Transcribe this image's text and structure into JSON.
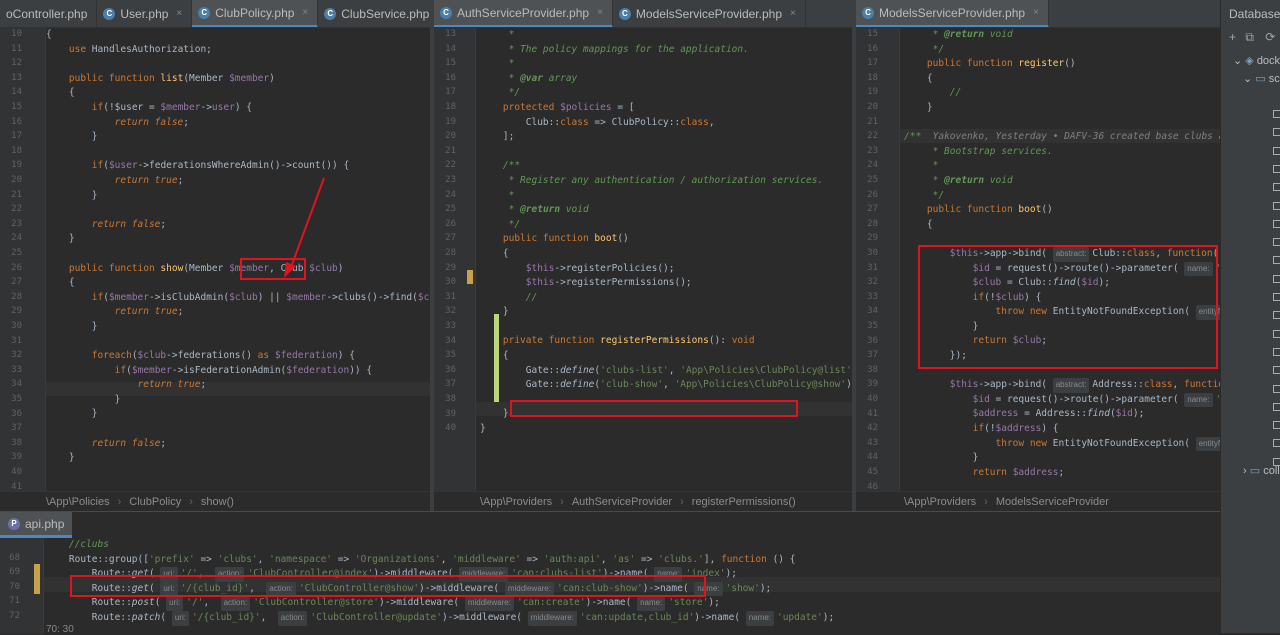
{
  "pane1": {
    "tabs": [
      {
        "label": "oController.php",
        "icon": "php-file-icon",
        "active": false
      },
      {
        "label": "User.php",
        "icon": "php-file-icon",
        "active": false
      },
      {
        "label": "ClubPolicy.php",
        "icon": "php-file-icon",
        "active": true
      },
      {
        "label": "ClubService.php",
        "icon": "php-file-icon",
        "active": false
      },
      {
        "label": "≡",
        "icon": "more-tabs-icon",
        "active": false
      }
    ],
    "line_numbers": [
      "10",
      "11",
      "12",
      "13",
      "14",
      "15",
      "16",
      "17",
      "18",
      "19",
      "20",
      "21",
      "22",
      "23",
      "24",
      "25",
      "26",
      "27",
      "28",
      "29",
      "30",
      "31",
      "32",
      "33",
      "34",
      "35",
      "36",
      "37",
      "38",
      "39",
      "40",
      "41"
    ],
    "breadcrumb": [
      "\\App\\Policies",
      "ClubPolicy",
      "show()"
    ]
  },
  "pane2": {
    "tabs": [
      {
        "label": "AuthServiceProvider.php",
        "icon": "php-file-icon",
        "active": true
      },
      {
        "label": "ModelsServiceProvider.php",
        "icon": "php-file-icon",
        "active": false
      }
    ],
    "line_numbers": [
      "13",
      "14",
      "15",
      "16",
      "17",
      "18",
      "19",
      "20",
      "21",
      "22",
      "23",
      "24",
      "25",
      "26",
      "27",
      "28",
      "29",
      "30",
      "31",
      "32",
      "33",
      "34",
      "35",
      "36",
      "37",
      "38",
      "39",
      "40"
    ],
    "breadcrumb": [
      "\\App\\Providers",
      "AuthServiceProvider",
      "registerPermissions()"
    ]
  },
  "pane3": {
    "tabs": [
      {
        "label": "ModelsServiceProvider.php",
        "icon": "php-file-icon",
        "active": true
      }
    ],
    "line_numbers": [
      "15",
      "16",
      "17",
      "18",
      "19",
      "20",
      "21",
      "22",
      "23",
      "24",
      "25",
      "26",
      "27",
      "28",
      "29",
      "30",
      "31",
      "32",
      "33",
      "34",
      "35",
      "36",
      "37",
      "38",
      "39",
      "40",
      "41",
      "42",
      "43",
      "44",
      "45",
      "46"
    ],
    "breadcrumb": [
      "\\App\\Providers",
      "ModelsServiceProvider"
    ],
    "blame": "Yakovenko, Yesterday • DAFV-36 created base clubs actions"
  },
  "bottom": {
    "tab": "api.php",
    "line_numbers": [
      "68",
      "69",
      "70",
      "71",
      "72"
    ],
    "status": "70:  30"
  },
  "database": {
    "title": "Database",
    "tree": [
      "docke",
      "sch",
      "coll"
    ]
  },
  "colors": {
    "accent": "#4a88c7",
    "highlight": "#e0141e",
    "bg": "#2b2b2b"
  }
}
